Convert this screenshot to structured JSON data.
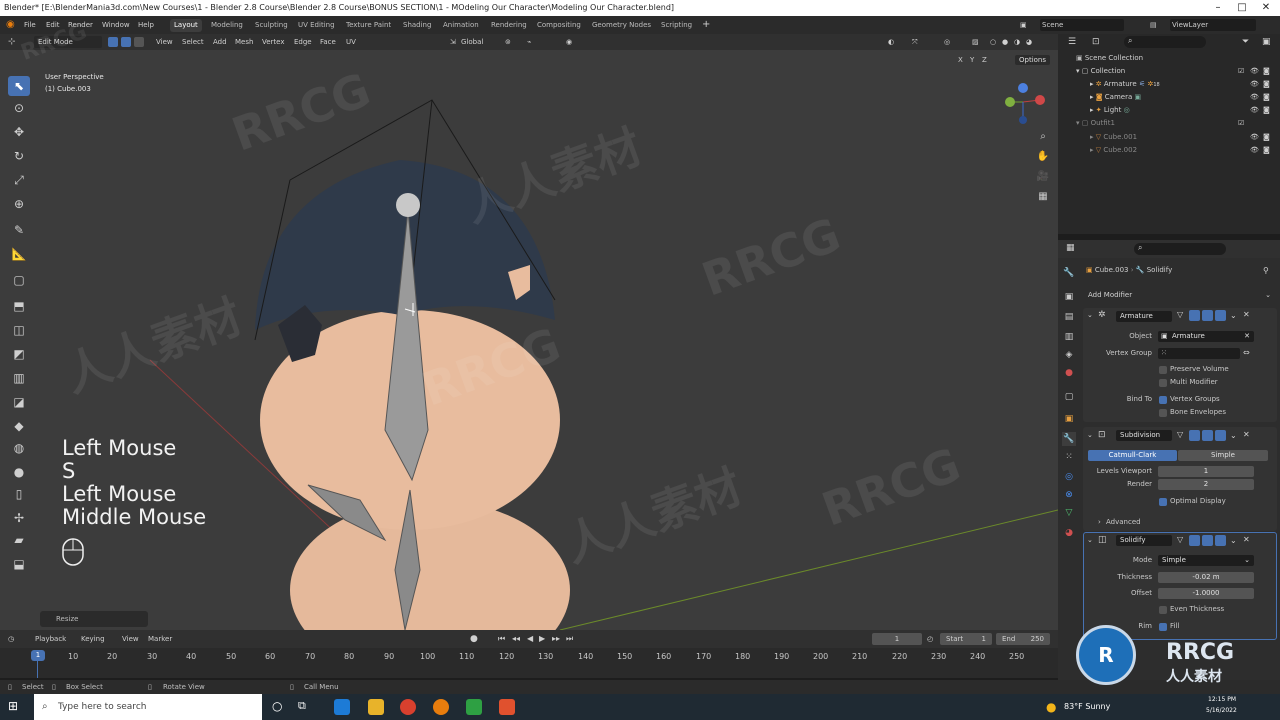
{
  "title": "Blender* [E:\\BlenderMania3d.com\\New Courses\\1 - Blender 2.8 Course\\Blender 2.8 Course\\BONUS SECTION\\1 - MOdeling Our Character\\Modeling Our Character.blend]",
  "menus": [
    "File",
    "Edit",
    "Render",
    "Window",
    "Help"
  ],
  "workspaces": [
    "Layout",
    "Modeling",
    "Sculpting",
    "UV Editing",
    "Texture Paint",
    "Shading",
    "Animation",
    "Rendering",
    "Compositing",
    "Geometry Nodes",
    "Scripting"
  ],
  "active_workspace": "Layout",
  "scene": "Scene",
  "view_layer": "ViewLayer",
  "header3d": {
    "mode": "Edit Mode",
    "menus": [
      "View",
      "Select",
      "Add",
      "Mesh",
      "Vertex",
      "Edge",
      "Face",
      "UV"
    ],
    "orientation": "Global",
    "options": "Options",
    "xyz": [
      "X",
      "Y",
      "Z"
    ]
  },
  "viewport": {
    "perspective": "User Perspective",
    "object": "(1) Cube.003"
  },
  "keys": [
    "Left Mouse",
    "S",
    "Left Mouse",
    "Middle Mouse"
  ],
  "resize_label": "Resize",
  "outliner": {
    "scene_collection": "Scene Collection",
    "collection": "Collection",
    "items": [
      "Armature",
      "Camera",
      "Light"
    ],
    "outfit": "Outfit1",
    "outfit_items": [
      "Cube.001",
      "Cube.002"
    ],
    "count": "18"
  },
  "properties": {
    "breadcrumb_obj": "Cube.003",
    "breadcrumb_mod": "Solidify",
    "add_modifier": "Add Modifier",
    "armature": {
      "name": "Armature",
      "object_label": "Object",
      "object_value": "Armature",
      "vgroup_label": "Vertex Group",
      "preserve_volume": "Preserve Volume",
      "multi_modifier": "Multi Modifier",
      "bind_to": "Bind To",
      "vertex_groups": "Vertex Groups",
      "bone_envelopes": "Bone Envelopes"
    },
    "subdivision": {
      "name": "Subdivision",
      "catmull": "Catmull-Clark",
      "simple": "Simple",
      "levels_label": "Levels Viewport",
      "levels_value": "1",
      "render_label": "Render",
      "render_value": "2",
      "optimal": "Optimal Display",
      "advanced": "Advanced"
    },
    "solidify": {
      "name": "Solidify",
      "mode_label": "Mode",
      "mode_value": "Simple",
      "thickness_label": "Thickness",
      "thickness_value": "-0.02 m",
      "offset_label": "Offset",
      "offset_value": "-1.0000",
      "even": "Even Thickness",
      "rim_label": "Rim",
      "fill": "Fill"
    }
  },
  "timeline": {
    "menus": [
      "Playback",
      "Keying",
      "View",
      "Marker"
    ],
    "current": "1",
    "start_label": "Start",
    "start": "1",
    "end_label": "End",
    "end": "250",
    "frames": [
      "10",
      "20",
      "30",
      "40",
      "50",
      "60",
      "70",
      "80",
      "90",
      "100",
      "110",
      "120",
      "130",
      "140",
      "150",
      "160",
      "170",
      "180",
      "190",
      "200",
      "210",
      "220",
      "230",
      "240",
      "250"
    ],
    "playhead": "1"
  },
  "status": [
    "Select",
    "Box Select",
    "Rotate View",
    "Call Menu"
  ],
  "taskbar": {
    "search": "Type here to search",
    "weather": "83°F  Sunny",
    "time": "12:15 PM",
    "date": "5/16/2022"
  },
  "watermark": "RRCG",
  "watermark_cn": "人人素材",
  "colors": {
    "accent": "#4772b3",
    "viewport": "#3c3c3c",
    "header": "#303030"
  }
}
